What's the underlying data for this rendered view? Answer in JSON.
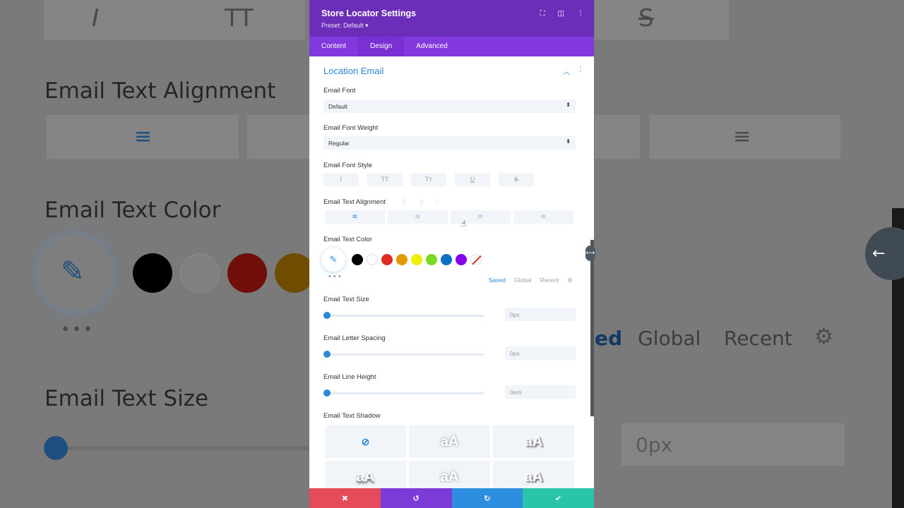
{
  "background": {
    "alignment_label": "Email Text Alignment",
    "color_label": "Email Text Color",
    "size_label": "Email Text Size",
    "saved_tab": "ed",
    "global_tab": "Global",
    "recent_tab": "Recent",
    "value": "0px"
  },
  "modal": {
    "title": "Store Locator Settings",
    "preset": "Preset: Default ▾",
    "tabs": [
      "Content",
      "Design",
      "Advanced"
    ],
    "active_tab": "Design",
    "section_title": "Location Email",
    "email_font": {
      "label": "Email Font",
      "value": "Default"
    },
    "email_font_weight": {
      "label": "Email Font Weight",
      "value": "Regular"
    },
    "email_font_style": {
      "label": "Email Font Style",
      "buttons": [
        "I",
        "TT",
        "Tт",
        "U",
        "S"
      ]
    },
    "email_text_alignment": {
      "label": "Email Text Alignment"
    },
    "email_text_color": {
      "label": "Email Text Color",
      "swatches": [
        "#000000",
        "#ffffff",
        "#e02b20",
        "#e09900",
        "#edf000",
        "#7cda24",
        "#0c71c3",
        "#8300e9"
      ],
      "tabs": [
        "Saved",
        "Global",
        "Recent"
      ]
    },
    "email_text_size": {
      "label": "Email Text Size",
      "value": "0px"
    },
    "email_letter_spacing": {
      "label": "Email Letter Spacing",
      "value": "0px"
    },
    "email_line_height": {
      "label": "Email Line Height",
      "value": "0em"
    },
    "email_text_shadow": {
      "label": "Email Text Shadow",
      "preview": "aA"
    }
  },
  "footer_colors": [
    "#e44c5a",
    "#7b3bd6",
    "#2d8ee0",
    "#29c4a9"
  ]
}
